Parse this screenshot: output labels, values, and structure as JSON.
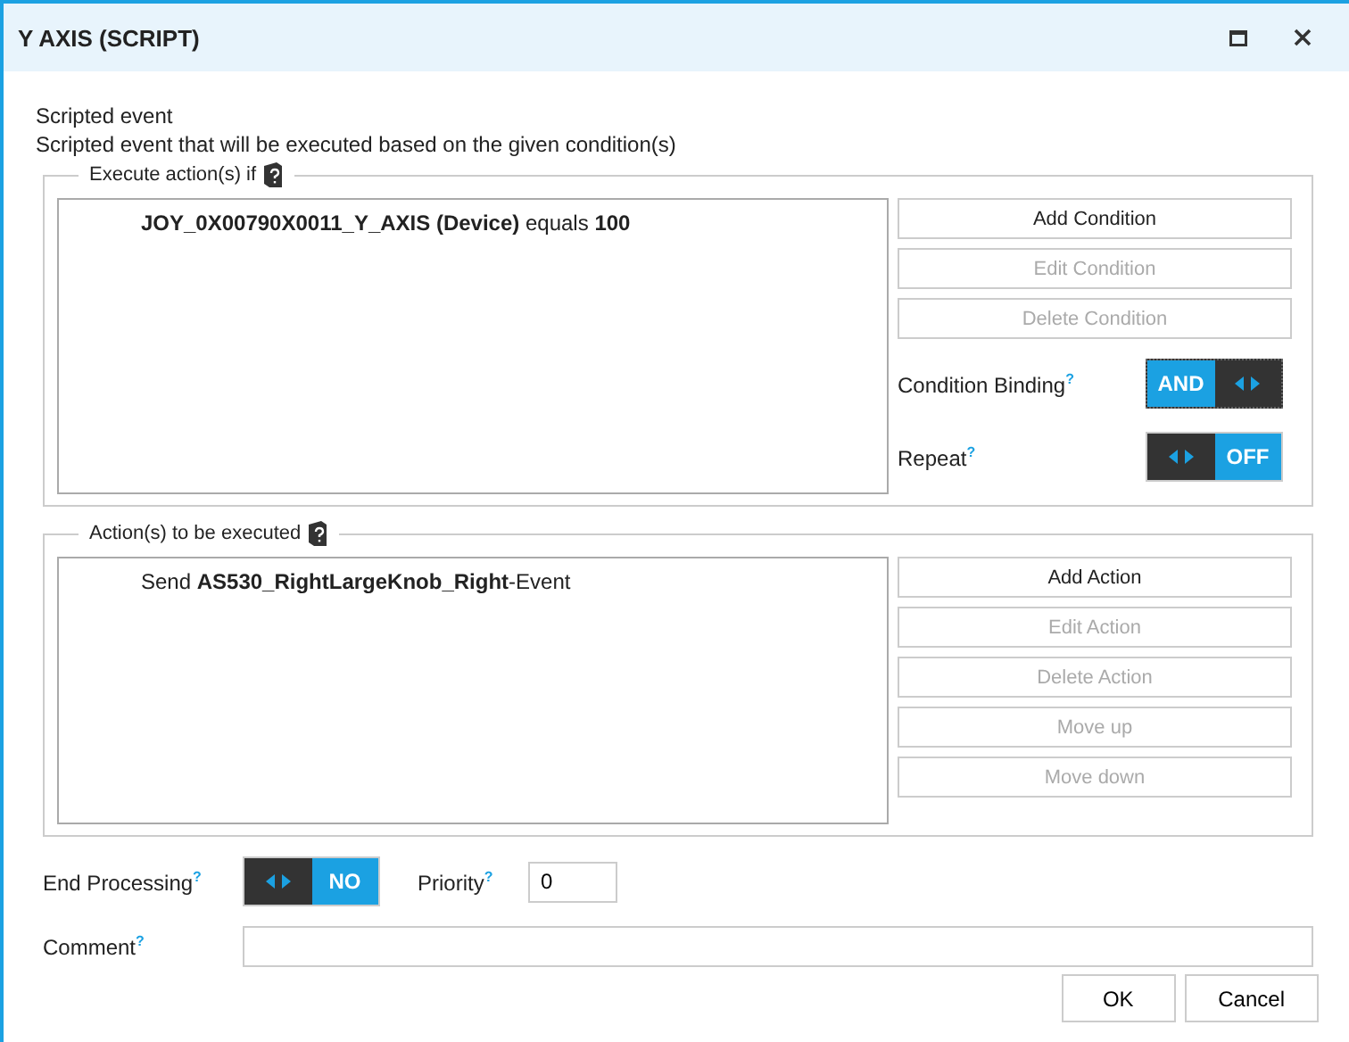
{
  "window": {
    "title": "Y AXIS (SCRIPT)"
  },
  "description": {
    "title": "Scripted event",
    "text": "Scripted event that will be executed based on the given condition(s)"
  },
  "conditions_group": {
    "legend": "Execute action(s) if",
    "items": [
      "**JOY_0X00790X0011_Y_AXIS (Device)** equals **100**"
    ],
    "buttons": [
      {
        "label": "Add Condition",
        "disabled": false
      },
      {
        "label": "Edit Condition",
        "disabled": true
      },
      {
        "label": "Delete Condition",
        "disabled": true
      }
    ],
    "toggles": [
      {
        "label": "Condition Binding",
        "help": "?",
        "value": "AND",
        "value_first": true,
        "focused": true
      },
      {
        "label": "Repeat",
        "help": "?",
        "value": "OFF",
        "value_first": false,
        "focused": false
      }
    ]
  },
  "actions_group": {
    "legend": "Action(s) to be executed",
    "items": [
      "Send **AS530_RightLargeKnob_Right**-Event"
    ],
    "buttons": [
      {
        "label": "Add Action",
        "disabled": false
      },
      {
        "label": "Edit Action",
        "disabled": true
      },
      {
        "label": "Delete Action",
        "disabled": true
      },
      {
        "label": "Move up",
        "disabled": true
      },
      {
        "label": "Move down",
        "disabled": true
      }
    ]
  },
  "end_processing": {
    "label": "End Processing",
    "help": "?",
    "value": "NO",
    "value_first": false,
    "focused": false
  },
  "priority": {
    "label": "Priority",
    "help": "?",
    "value": "0"
  },
  "comment": {
    "label": "Comment",
    "help": "?"
  },
  "footer_buttons": [
    "OK",
    "Cancel"
  ]
}
